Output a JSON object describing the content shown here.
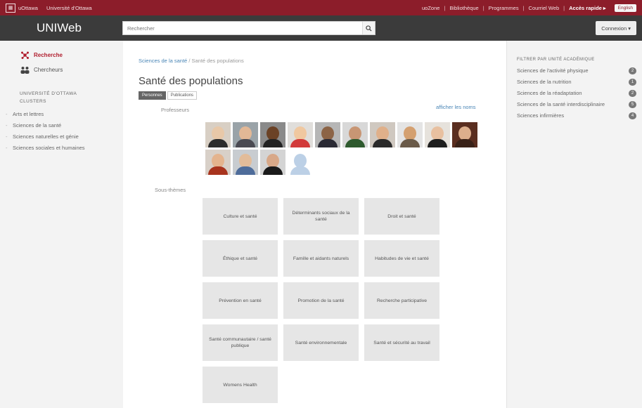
{
  "topbar": {
    "uottawa": "uOttawa",
    "univ": "Université d'Ottawa",
    "links": [
      "uoZone",
      "Bibliothèque",
      "Programmes",
      "Courriel Web"
    ],
    "quick_access": "Accès rapide ▸",
    "language": "English"
  },
  "header": {
    "brand": "UNIWeb",
    "search_placeholder": "Rechercher",
    "connexion": "Connexion ▾"
  },
  "left_nav": {
    "items": [
      {
        "label": "Recherche",
        "active": true
      },
      {
        "label": "Chercheurs",
        "active": false
      }
    ],
    "clusters_title_1": "UNIVERSITÉ D'OTTAWA",
    "clusters_title_2": "CLUSTERS",
    "clusters": [
      "Arts et lettres",
      "Sciences de la santé",
      "Sciences naturelles et génie",
      "Sciences sociales et humaines"
    ]
  },
  "main": {
    "breadcrumb_link": "Sciences de la santé",
    "breadcrumb_sep": "/",
    "breadcrumb_current": "Santé des populations",
    "title": "Santé des populations",
    "tabs": [
      "Personnes",
      "Publications"
    ],
    "professors_label": "Professeurs",
    "show_names": "afficher les noms",
    "subthemes_label": "Sous-thèmes",
    "themes": [
      "Culture et santé",
      "Déterminants sociaux de la santé",
      "Droit et santé",
      "Éthique et santé",
      "Famille et aidants naturels",
      "Habitudes de vie et santé",
      "Prévention en santé",
      "Promotion de la santé",
      "Recherche participative",
      "Santé communautaire / santé publique",
      "Santé environnementale",
      "Santé et sécurité au travail",
      "Womens Health"
    ]
  },
  "right": {
    "filter_title": "FILTRER PAR UNITÉ ACADÉMIQUE",
    "filters": [
      {
        "label": "Sciences de l'activité physique",
        "count": "2"
      },
      {
        "label": "Sciences de la nutrition",
        "count": "1"
      },
      {
        "label": "Sciences de la réadaptation",
        "count": "2"
      },
      {
        "label": "Sciences de la santé interdisciplinaire",
        "count": "5"
      },
      {
        "label": "Sciences infirmières",
        "count": "4"
      }
    ]
  },
  "colors": {
    "brand_red": "#8c1d2a",
    "header_dark": "#3b3b3b",
    "link_blue": "#4a86b6",
    "active_red": "#b01e2e"
  }
}
